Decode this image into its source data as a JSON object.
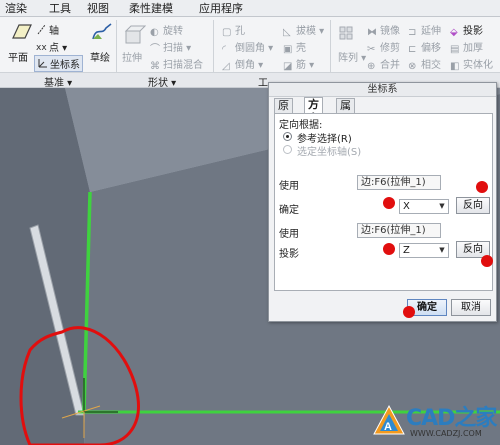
{
  "ribbon": {
    "tabs": [
      "渲染",
      "工具",
      "视图",
      "柔性建模",
      "应用程序"
    ],
    "groups": [
      "基准",
      "形状",
      "工"
    ],
    "datum": {
      "plane": "平面",
      "axis": "轴",
      "point": "点",
      "csys": "坐标系"
    },
    "shape": {
      "sketch": "草绘",
      "extrude": "拉伸",
      "revolve": "旋转",
      "sweep": "扫描",
      "swept_blend": "扫描混合"
    },
    "engineering": {
      "hole": "孔",
      "round": "倒圆角",
      "chamfer": "倒角",
      "draft": "拔模",
      "shell": "壳",
      "rib": "筋"
    },
    "editing": {
      "pattern": "阵列",
      "mirror": "镜像",
      "trim": "修剪",
      "merge": "合并",
      "extend": "延伸",
      "offset": "偏移",
      "intersect": "相交",
      "project": "投影",
      "thicken": "加厚",
      "solidify": "实体化"
    }
  },
  "dialog": {
    "title": "坐标系",
    "tabs": [
      "原点",
      "方向",
      "属性"
    ],
    "orient_by_label": "定向根据:",
    "radio_ref_selection": "参考选择(R)",
    "radio_select_csys_axes": "选定坐标轴(S)",
    "row1": {
      "use_label": "使用",
      "use_value": "边:F6(拉伸_1)",
      "determine_label": "确定",
      "axis_value": "X",
      "flip_label": "反向"
    },
    "row2": {
      "use_label": "使用",
      "use_value": "边:F6(拉伸_1)",
      "project_label": "投影",
      "axis_value": "Z",
      "flip_label": "反向"
    },
    "ok_label": "确定",
    "cancel_label": "取消"
  },
  "watermark": {
    "text": "CAD之家",
    "url": "WWW.CADZJ.COM"
  },
  "colors": {
    "highlight_edge": "#3fd23f",
    "marker": "#e10e0e",
    "model_face": "#6f7783",
    "background": "#b9c1cb"
  }
}
